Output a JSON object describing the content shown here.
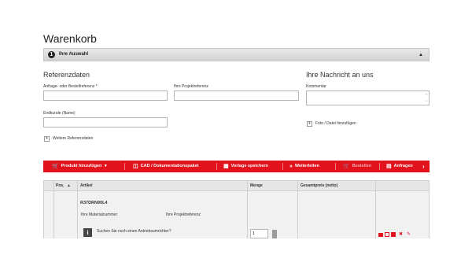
{
  "page_title": "Warenkorb",
  "accordion": {
    "step": "1",
    "title": "Ihre Auswahl",
    "caret": "▲"
  },
  "referenzdaten": {
    "heading": "Referenzdaten",
    "anfrage_label": "Anfrage- oder Bestellreferenz *",
    "projekt_label": "Ihre Projektreferenz",
    "endkunde_label": "Endkunde (Name)",
    "weitere_label": "Weitere Referenzdaten"
  },
  "nachricht": {
    "heading": "Ihre Nachricht an uns",
    "kommentar_label": "Kommentar",
    "foto_label": "Foto / Datei hinzufügen"
  },
  "toolbar": {
    "produkt": "Produkt hinzufügen",
    "cad": "CAD / Dokumentationspaket",
    "vorlage": "Vorlage speichern",
    "weiterleiten": "Weiterleiten",
    "bestellen": "Bestellen",
    "anfragen": "Anfragen"
  },
  "table": {
    "headers": {
      "pos": "Pos.",
      "artikel": "Artikel",
      "menge": "Menge",
      "gesamtpreis": "Gesamtpreis (netto)"
    },
    "row": {
      "article_code": "R37DRN90L4",
      "materialnummer_label": "Ihre Materialnummer",
      "projektreferenz_label": "Ihre Projektreferenz",
      "info_text": "Suchen Sie noch einen Antriebsumrichter?",
      "quantity": "1"
    }
  },
  "colors": {
    "toolbar_red": "#e2121c"
  }
}
